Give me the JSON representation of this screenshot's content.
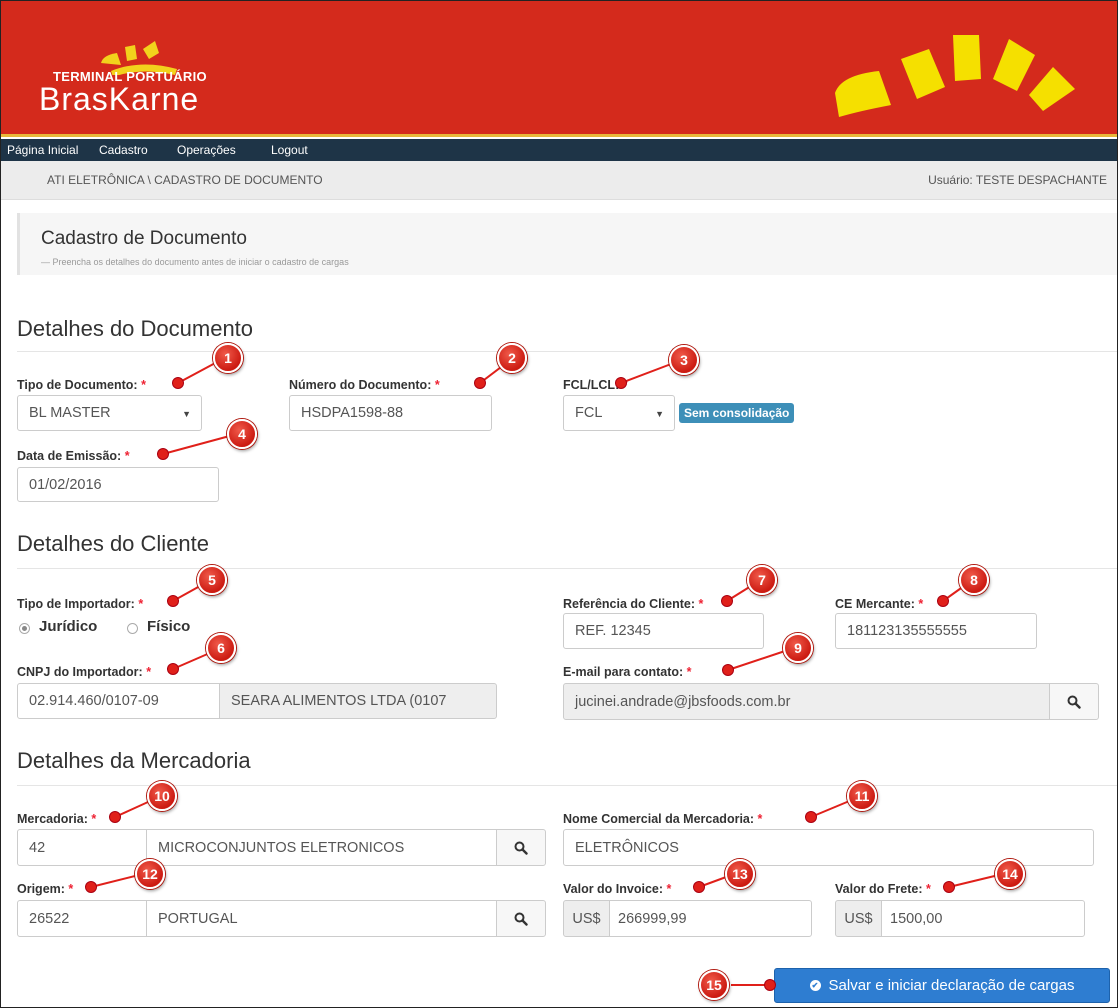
{
  "colors": {
    "header": "#d42a1c",
    "nav": "#1e3447",
    "accent": "#e8b83a",
    "primary_button": "#2e7dd1",
    "marker": "#e0201a"
  },
  "brand": {
    "subtitle": "TERMINAL PORTUÁRIO",
    "name": "BrasKarne"
  },
  "nav": {
    "items": [
      "Página Inicial",
      "Cadastro",
      "Operações",
      "Logout"
    ]
  },
  "breadcrumb": "ATI ELETRÔNICA \\ CADASTRO DE DOCUMENTO",
  "user": "Usuário: TESTE DESPACHANTE",
  "page": {
    "title": "Cadastro de Documento",
    "subtitle": "— Preencha os detalhes do documento antes de iniciar o cadastro de cargas"
  },
  "required_mark": "*",
  "documento": {
    "title": "Detalhes do Documento",
    "tipo": {
      "label": "Tipo de Documento:",
      "value": "BL MASTER"
    },
    "numero": {
      "label": "Número do Documento:",
      "value": "HSDPA1598-88"
    },
    "fcl": {
      "label": "FCL/LCL:",
      "value": "FCL",
      "badge": "Sem consolidação"
    },
    "data": {
      "label": "Data de Emissão:",
      "value": "01/02/2016"
    }
  },
  "cliente": {
    "title": "Detalhes do Cliente",
    "tipo_importador": {
      "label": "Tipo de Importador:",
      "options": [
        "Jurídico",
        "Físico"
      ],
      "selected": "Jurídico"
    },
    "referencia": {
      "label": "Referência do Cliente:",
      "value": "REF. 12345"
    },
    "ce": {
      "label": "CE Mercante:",
      "value": "181123135555555"
    },
    "cnpj": {
      "label": "CNPJ do Importador:",
      "value": "02.914.460/0107-09",
      "name": "SEARA ALIMENTOS LTDA (0107"
    },
    "email": {
      "label": "E-mail para contato:",
      "value": "jucinei.andrade@jbsfoods.com.br"
    }
  },
  "mercadoria": {
    "title": "Detalhes da Mercadoria",
    "mercadoria": {
      "label": "Mercadoria:",
      "code": "42",
      "desc": "MICROCONJUNTOS ELETRONICOS"
    },
    "nome": {
      "label": "Nome Comercial da Mercadoria:",
      "value": "ELETRÔNICOS"
    },
    "origem": {
      "label": "Origem:",
      "code": "26522",
      "desc": "PORTUGAL"
    },
    "invoice": {
      "label": "Valor do Invoice:",
      "currency": "US$",
      "value": "266999,99"
    },
    "frete": {
      "label": "Valor do Frete:",
      "currency": "US$",
      "value": "1500,00"
    }
  },
  "save_button": "Salvar e iniciar declaração de cargas",
  "markers": [
    "1",
    "2",
    "3",
    "4",
    "5",
    "6",
    "7",
    "8",
    "9",
    "10",
    "11",
    "12",
    "13",
    "14",
    "15"
  ]
}
